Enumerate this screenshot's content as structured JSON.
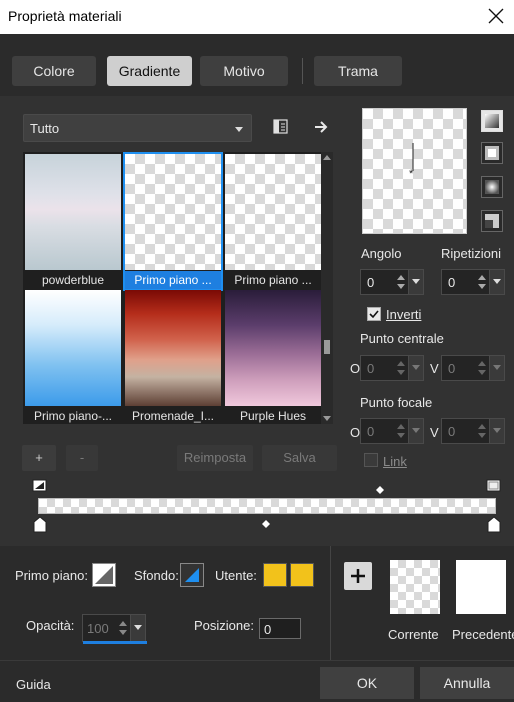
{
  "window": {
    "title": "Proprietà materiali"
  },
  "tabs": [
    {
      "label": "Colore"
    },
    {
      "label": "Gradiente"
    },
    {
      "label": "Motivo"
    },
    {
      "label": "Trama"
    }
  ],
  "category_dropdown": {
    "value": "Tutto"
  },
  "gradients": [
    {
      "label": "powderblue",
      "selected": false
    },
    {
      "label": "Primo piano ...",
      "selected": true
    },
    {
      "label": "Primo piano ...",
      "selected": false
    },
    {
      "label": "Primo piano-...",
      "selected": false
    },
    {
      "label": "Promenade_I...",
      "selected": false
    },
    {
      "label": "Purple Hues",
      "selected": false
    }
  ],
  "list_buttons": {
    "add": "+",
    "remove": "-",
    "reset": "Reimposta",
    "save": "Salva"
  },
  "properties": {
    "angle_label": "Angolo",
    "angle_value": "0",
    "repeats_label": "Ripetizioni",
    "repeats_value": "0",
    "invert_label": "Inverti",
    "invert_checked": true,
    "center_label": "Punto centrale",
    "center_o_label": "O",
    "center_o_value": "0",
    "center_v_label": "V",
    "center_v_value": "0",
    "focal_label": "Punto focale",
    "focal_o_label": "O",
    "focal_o_value": "0",
    "focal_v_label": "V",
    "focal_v_value": "0",
    "link_label": "Link"
  },
  "bottom": {
    "foreground_label": "Primo piano:",
    "background_label": "Sfondo:",
    "user_label": "Utente:",
    "user_color": "#f2c21b",
    "opacity_label": "Opacità:",
    "opacity_value": "100",
    "position_label": "Posizione:",
    "position_value": "0",
    "current_label": "Corrente",
    "previous_label": "Precedente"
  },
  "footer": {
    "help": "Guida",
    "ok": "OK",
    "cancel": "Annulla"
  }
}
